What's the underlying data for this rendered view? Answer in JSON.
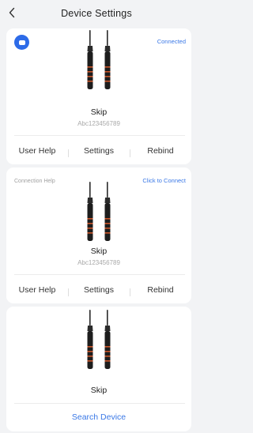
{
  "header": {
    "title": "Device Settings"
  },
  "cards": [
    {
      "status": "Connected",
      "name": "Skip",
      "serial": "Abc123456789",
      "actions": [
        "User Help",
        "Settings",
        "Rebind"
      ]
    },
    {
      "left_label": "Connection Help",
      "status": "Click to Connect",
      "name": "Skip",
      "serial": "Abc123456789",
      "actions": [
        "User Help",
        "Settings",
        "Rebind"
      ]
    },
    {
      "name": "Skip",
      "action": "Search Device"
    }
  ],
  "icons": {
    "back": "chevron-left-icon",
    "badge": "device-badge-icon",
    "device": "jump-rope-icon"
  },
  "colors": {
    "accent": "#3a78e6",
    "badge": "#2d6be8",
    "handle_stripe": "#c8552a"
  }
}
